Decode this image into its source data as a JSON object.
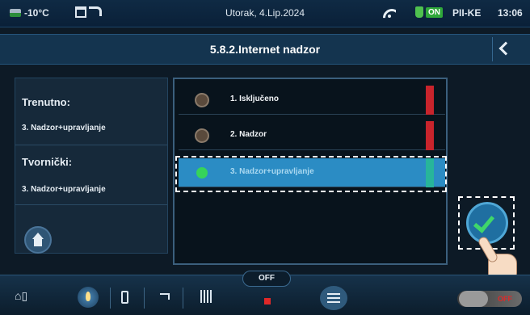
{
  "status_bar": {
    "outdoor_temp": "-10°C",
    "date": "Utorak, 4.Lip.2024",
    "power_status": "ON",
    "model": "PII-KE",
    "time": "13:06"
  },
  "header": {
    "title": "5.8.2.Internet nadzor"
  },
  "info": {
    "current_label": "Trenutno:",
    "current_value": "3. Nadzor+upravljanje",
    "factory_label": "Tvornički:",
    "factory_value": "3. Nadzor+upravljanje"
  },
  "options": [
    {
      "label": "1. Isključeno",
      "selected": false,
      "bar_color": "#c8242c"
    },
    {
      "label": "2. Nadzor",
      "selected": false,
      "bar_color": "#c8242c"
    },
    {
      "label": "3. Nadzor+upravljanje",
      "selected": true,
      "bar_color": "#27b59a"
    }
  ],
  "bottom_bar": {
    "mode_label": "OFF",
    "power_toggle_label": "OFF"
  },
  "colors": {
    "accent": "#2b8cc4",
    "selected_radio": "#36d35a",
    "confirm_check": "#3fd66a",
    "alert_red": "#e02828"
  }
}
